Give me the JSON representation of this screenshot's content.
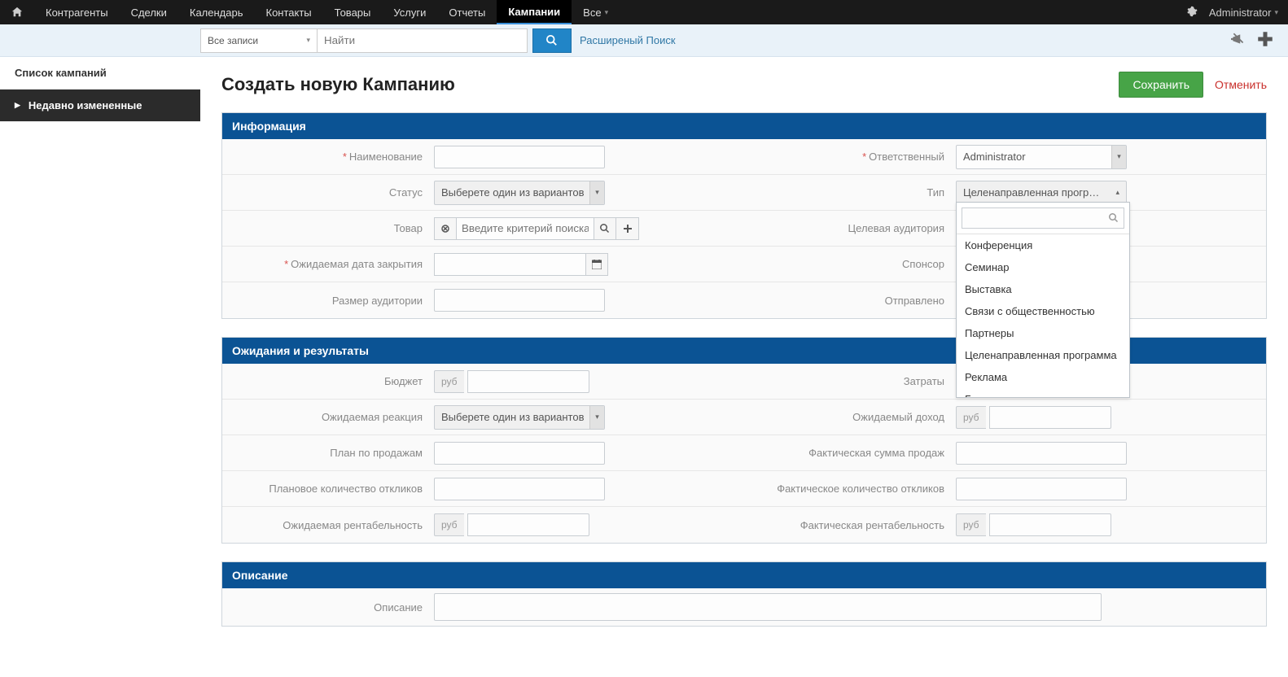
{
  "topnav": {
    "items": [
      "Контрагенты",
      "Сделки",
      "Календарь",
      "Контакты",
      "Товары",
      "Услуги",
      "Отчеты",
      "Кампании",
      "Все"
    ],
    "active_index": 7,
    "user": "Administrator"
  },
  "searchbar": {
    "scope": "Все записи",
    "placeholder": "Найти",
    "advanced": "Расширеный Поиск"
  },
  "sidebar": {
    "items": [
      {
        "label": "Список кампаний"
      },
      {
        "label": "Недавно измененные"
      }
    ]
  },
  "page": {
    "title": "Создать новую Кампанию",
    "save": "Сохранить",
    "cancel": "Отменить"
  },
  "panel_info": {
    "title": "Информация",
    "labels": {
      "name": "Наименование",
      "responsible": "Ответственный",
      "status": "Статус",
      "type": "Тип",
      "product": "Товар",
      "target_audience": "Целевая аудитория",
      "close_date": "Ожидаемая дата закрытия",
      "sponsor": "Спонсор",
      "audience_size": "Размер аудитории",
      "sent": "Отправлено"
    },
    "values": {
      "responsible": "Administrator",
      "status_placeholder": "Выберете один из вариантов",
      "type_selected": "Целенаправленная програм...",
      "product_placeholder": "Введите критерий поиска"
    },
    "type_dropdown": {
      "options": [
        "Конференция",
        "Семинар",
        "Выставка",
        "Связи с общественностью",
        "Партнеры",
        "Целенаправленная программа",
        "Реклама",
        "Баннеры"
      ]
    }
  },
  "panel_results": {
    "title": "Ожидания и результаты",
    "labels": {
      "budget": "Бюджет",
      "costs": "Затраты",
      "expected_response": "Ожидаемая реакция",
      "expected_revenue": "Ожидаемый доход",
      "sales_plan": "План по продажам",
      "actual_sales": "Фактическая сумма продаж",
      "planned_responses": "Плановое количество откликов",
      "actual_responses": "Фактическое количество откликов",
      "expected_roi": "Ожидаемая рентабельность",
      "actual_roi": "Фактическая рентабельность"
    },
    "values": {
      "currency_prefix": "руб",
      "expected_response_placeholder": "Выберете один из вариантов"
    }
  },
  "panel_desc": {
    "title": "Описание",
    "labels": {
      "description": "Описание"
    }
  }
}
